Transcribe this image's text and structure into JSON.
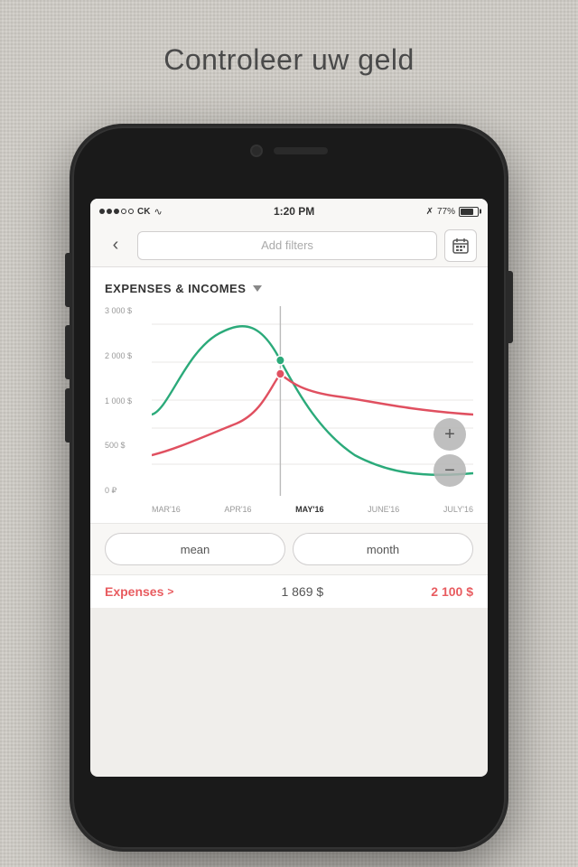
{
  "page": {
    "title": "Controleer uw geld",
    "background_color": "#ccc9c3"
  },
  "status_bar": {
    "signal_dots": [
      "filled",
      "filled",
      "filled",
      "empty",
      "empty"
    ],
    "carrier": "CK",
    "wifi": true,
    "time": "1:20 PM",
    "bluetooth": true,
    "battery_percent": "77%"
  },
  "nav": {
    "back_label": "‹",
    "filter_placeholder": "Add filters",
    "calendar_label": "calendar"
  },
  "chart": {
    "title": "EXPENSES & INCOMES",
    "dropdown_label": "▼",
    "y_labels": [
      "3 000 $",
      "2 000 $",
      "1 000 $",
      "500 $",
      "0 ₽"
    ],
    "x_labels": [
      "MAR'16",
      "APR'16",
      "MAY'16",
      "JUNE'16",
      "JULY'16"
    ],
    "active_x_label": "MAY'16",
    "green_color": "#2baa7a",
    "red_color": "#e05060",
    "vertical_line_color": "#aaa"
  },
  "zoom": {
    "plus_label": "+",
    "minus_label": "−"
  },
  "buttons": {
    "mean_label": "mean",
    "month_label": "month"
  },
  "expenses_row": {
    "label": "Expenses",
    "chevron": ">",
    "mean_value": "1 869 $",
    "month_value": "2 100 $"
  }
}
